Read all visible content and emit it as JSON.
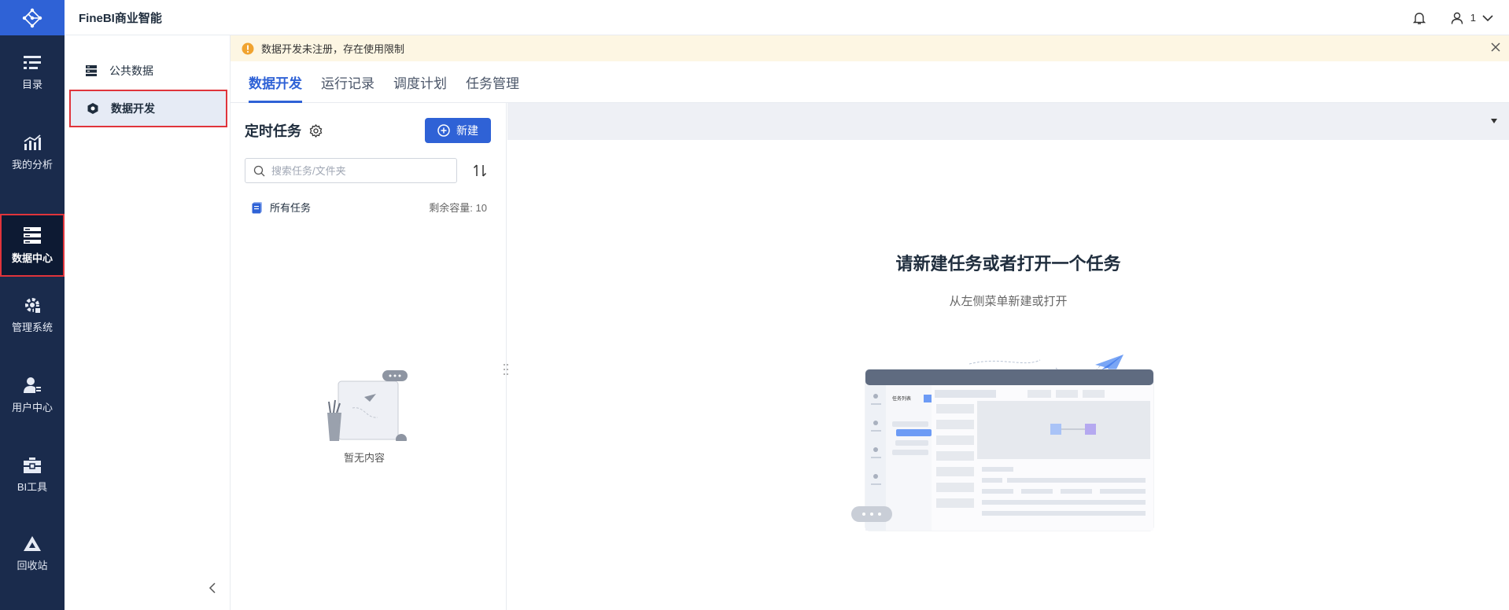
{
  "app": {
    "title": "FineBI商业智能"
  },
  "rail": {
    "items": [
      {
        "label": "目录",
        "icon": "catalog-icon"
      },
      {
        "label": "我的分析",
        "icon": "analysis-icon"
      },
      {
        "label": "数据中心",
        "icon": "data-center-icon",
        "active": true
      },
      {
        "label": "管理系统",
        "icon": "management-icon"
      },
      {
        "label": "用户中心",
        "icon": "user-center-icon"
      },
      {
        "label": "BI工具",
        "icon": "toolbox-icon"
      },
      {
        "label": "回收站",
        "icon": "recycle-icon"
      }
    ]
  },
  "header": {
    "user_name": "1"
  },
  "sidebar": {
    "items": [
      {
        "label": "公共数据",
        "icon": "public-data-icon"
      },
      {
        "label": "数据开发",
        "icon": "data-dev-icon",
        "active": true
      }
    ]
  },
  "banner": {
    "text": "数据开发未注册，存在使用限制"
  },
  "tabs": [
    {
      "label": "数据开发",
      "active": true
    },
    {
      "label": "运行记录"
    },
    {
      "label": "调度计划"
    },
    {
      "label": "任务管理"
    }
  ],
  "panel": {
    "title": "定时任务",
    "new_label": "新建",
    "search_placeholder": "搜索任务/文件夹",
    "all_tasks_label": "所有任务",
    "capacity_label": "剩余容量:",
    "capacity_value": "10",
    "empty_text": "暂无内容"
  },
  "main": {
    "title": "请新建任务或者打开一个任务",
    "subtitle": "从左侧菜单新建或打开"
  },
  "colors": {
    "accent": "#2f62d6",
    "rail_bg": "#1a2b4c",
    "highlight": "#e0343b",
    "banner_bg": "#fdf6e3"
  }
}
